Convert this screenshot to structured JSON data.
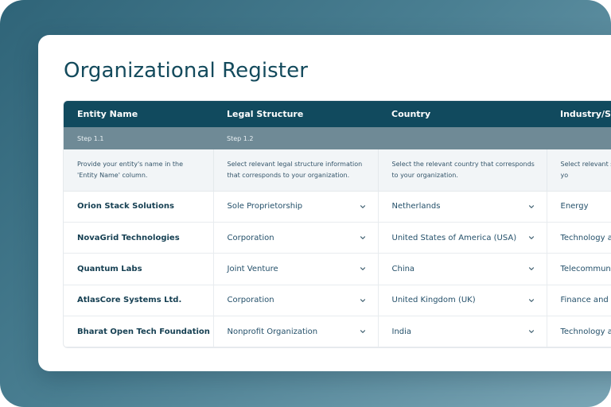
{
  "page": {
    "title": "Organizational Register"
  },
  "table": {
    "headers": [
      "Entity Name",
      "Legal Structure",
      "Country",
      "Industry/Sec"
    ],
    "steps": [
      "Step 1.1",
      "Step 1.2",
      "",
      ""
    ],
    "descriptions": [
      "Provide your entity's name in the 'Entity Name' column.",
      "Select relevant legal structure information that corresponds to your organization.",
      "Select the relevant country that corresponds to your organization.",
      "Select relevant s correspond to yo"
    ],
    "rows": [
      {
        "entity": "Orion Stack Solutions",
        "legal": "Sole Proprietorship",
        "country": "Netherlands",
        "industry": "Energy"
      },
      {
        "entity": "NovaGrid Technologies",
        "legal": "Corporation",
        "country": "United States of America (USA)",
        "industry": "Technology a"
      },
      {
        "entity": "Quantum Labs",
        "legal": "Joint Venture",
        "country": "China",
        "industry": "Telecommuni"
      },
      {
        "entity": "AtlasCore Systems Ltd.",
        "legal": "Corporation",
        "country": "United Kingdom (UK)",
        "industry": "Finance and"
      },
      {
        "entity": "Bharat Open Tech Foundation",
        "legal": "Nonprofit Organization",
        "country": "India",
        "industry": "Technology a"
      }
    ]
  },
  "colors": {
    "header_bg": "#114a5e",
    "step_bg": "#6f8a96",
    "title": "#134a5c",
    "background_gradient_start": "#2f6478",
    "background_gradient_end": "#7ba6b6"
  },
  "icons": {
    "dropdown": "chevron-down-icon"
  }
}
